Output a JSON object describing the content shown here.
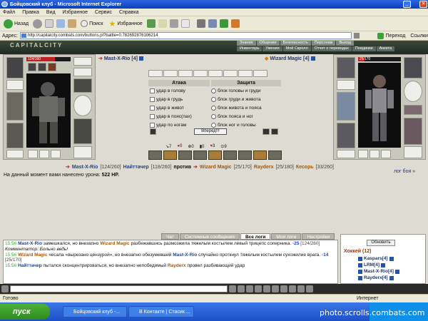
{
  "window": {
    "title": "Бойцовский клуб - Microsoft Internet Explorer"
  },
  "menu": [
    "Файл",
    "Правка",
    "Вид",
    "Избранное",
    "Сервис",
    "Справка"
  ],
  "toolbar": {
    "back": "Назад",
    "search": "Поиск",
    "favorites": "Избранное"
  },
  "address": {
    "label": "Адрес:",
    "url": "http://capitalcity.combats.com/buttons.pl?battle=0.782692876106214",
    "go": "Переход",
    "links": "Ссылки"
  },
  "game": {
    "logo": "CAPITALCITY",
    "nav1": [
      "Знания",
      "Общение",
      "Безопасность",
      "Персонаж",
      "Выход"
    ],
    "nav2": [
      "Инвентарь",
      "Умения",
      "Мой Скролл",
      "Отчет о переводах",
      "Поединки",
      "Анкета"
    ],
    "left_hp": "124/160",
    "right_hp": "25/170",
    "left_fighter": "Mast-X-Rio [4]",
    "right_fighter": "Wizard Magic [4]",
    "attack_header": "Атака",
    "defense_header": "Защита",
    "attacks": [
      "удар в голову",
      "удар в грудь",
      "удар в живот",
      "удар в пояс(пах)",
      "удар по ногам"
    ],
    "defenses": [
      "блок головы и груди",
      "блок груди и живота",
      "блок живота и пояса",
      "блок пояса и ног",
      "блок ног и головы"
    ],
    "forward_button": "Вперед!!!",
    "stats": [
      "7",
      "0",
      "0",
      "0",
      "3",
      "9"
    ],
    "team_left": [
      {
        "name": "Mast-X-Rio",
        "hp": "[124/260]"
      },
      {
        "name": "Найттачер",
        "hp": "[118/260]"
      }
    ],
    "vs": "против",
    "team_right": [
      {
        "name": "Wizard Magic",
        "hp": "[25/170]"
      },
      {
        "name": "Rayderx",
        "hp": "[25/180]"
      },
      {
        "name": "Кесорь",
        "hp": "[33/260]"
      }
    ],
    "damage_text": "На данный момент вами нанесено урона:",
    "damage_value": "522 HP.",
    "log_link": "лог боя »"
  },
  "chat": {
    "tabs": [
      "Чат",
      "Системные сообщения",
      "Все логи",
      "Мои логи",
      "Настройки"
    ],
    "active_tab": "Все логи",
    "lines": [
      {
        "time": "15:56",
        "actor": "Mast-X-Rio",
        "t1": " замешкался, но внезапно ",
        "target": "Wizard Magic",
        "t2": " разбежавшись размозжила тяжелым костылем левый трицепс соперника. ",
        "dmg": "-25",
        "hp": " [124/260]"
      },
      {
        "time": "",
        "actor": "",
        "t1": "Комментатор: Больно ведь!",
        "target": "",
        "t2": "",
        "dmg": "",
        "hp": ""
      },
      {
        "time": "15:56",
        "actor": "Wizard Magic",
        "t1": " чесала «вырезано цензурой», но внезапно обезумевший ",
        "target": "Mast-X-Rio",
        "t2": " случайно проткнул тяжелым костылем сухожилие врага. ",
        "dmg": "-14",
        "hp": " [25/170]"
      },
      {
        "time": "15:56",
        "actor": "Найттачер",
        "t1": " пытался сконцентрироваться, но внезапно непобедимый ",
        "target": "Rayderx",
        "t2": " провел разбивающий удар",
        "dmg": "",
        "hp": ""
      }
    ]
  },
  "who": {
    "refresh": "Обновить",
    "group": "Хоккей (12)",
    "users": [
      "Kaspars[4]",
      "LRM[4]",
      "Mast-X-Rio[4]",
      "Rayderx[4]"
    ]
  },
  "statusbar": {
    "left": "Готово",
    "right": "Интернет"
  },
  "taskbar": {
    "start": "пуск",
    "tasks": [
      "Бойцовский клуб -...",
      "В Контакте | Стасик ..."
    ]
  },
  "watermark": "photo.scrolls.combats.com"
}
